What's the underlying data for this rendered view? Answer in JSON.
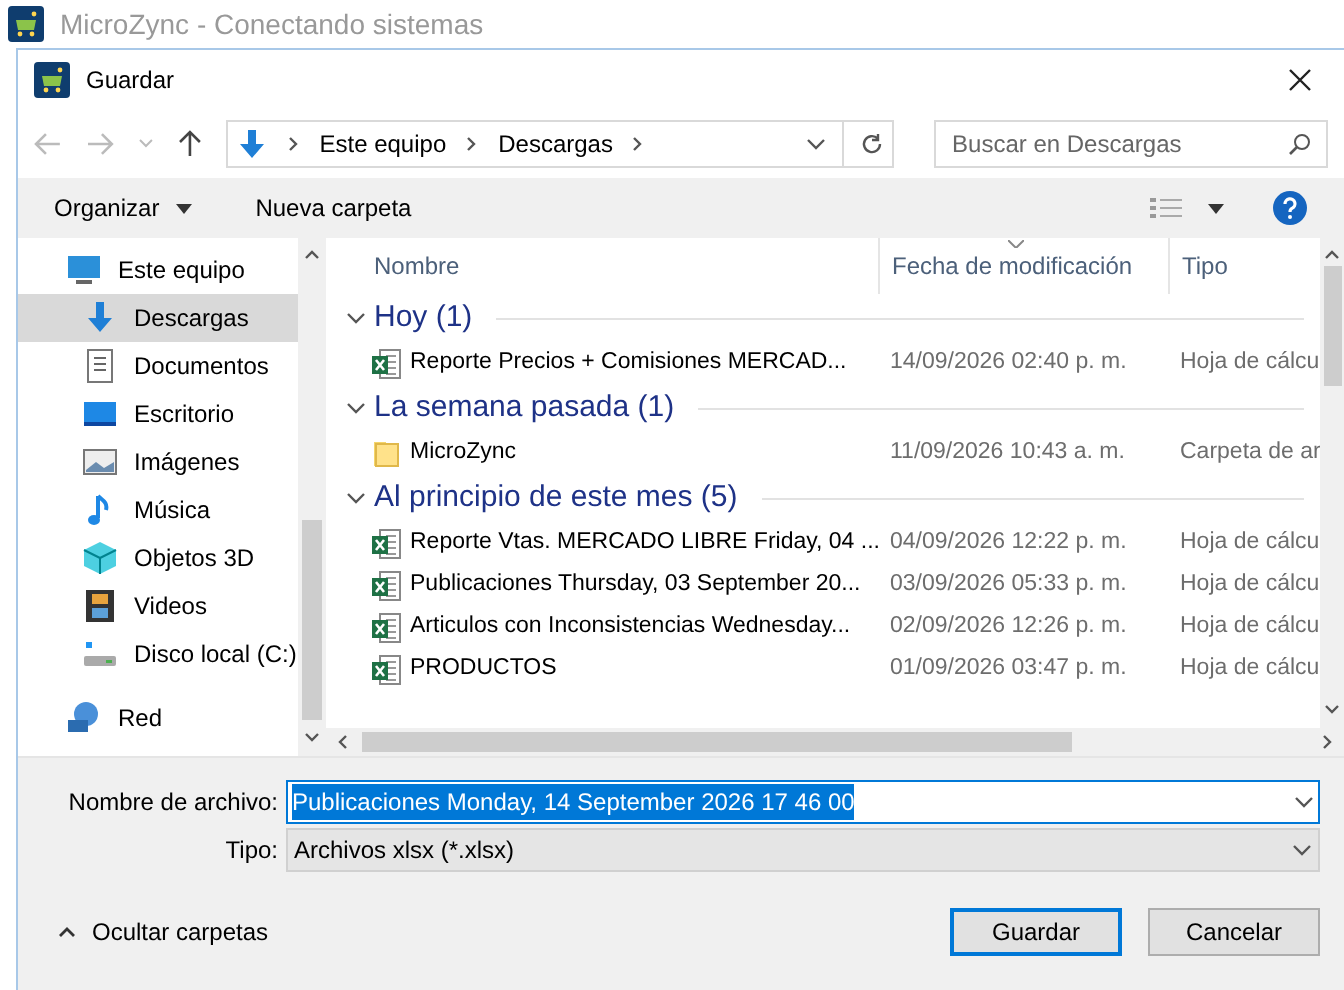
{
  "app_window": {
    "title": "MicroZync - Conectando sistemas"
  },
  "dialog": {
    "title": "Guardar"
  },
  "breadcrumb": [
    "Este equipo",
    "Descargas"
  ],
  "search": {
    "placeholder": "Buscar en Descargas"
  },
  "toolbar": {
    "organize": "Organizar",
    "new_folder": "Nueva carpeta"
  },
  "sidebar": {
    "items": [
      {
        "label": "Este equipo",
        "kind": "computer",
        "selected": false
      },
      {
        "label": "Descargas",
        "kind": "downloads",
        "selected": true
      },
      {
        "label": "Documentos",
        "kind": "documents",
        "selected": false
      },
      {
        "label": "Escritorio",
        "kind": "desktop",
        "selected": false
      },
      {
        "label": "Imágenes",
        "kind": "pictures",
        "selected": false
      },
      {
        "label": "Música",
        "kind": "music",
        "selected": false
      },
      {
        "label": "Objetos 3D",
        "kind": "objects",
        "selected": false
      },
      {
        "label": "Videos",
        "kind": "videos",
        "selected": false
      },
      {
        "label": "Disco local (C:)",
        "kind": "drive",
        "selected": false
      },
      {
        "label": "Red",
        "kind": "network",
        "selected": false
      }
    ]
  },
  "table": {
    "columns": [
      "Nombre",
      "Fecha de modificación",
      "Tipo"
    ],
    "groups": [
      {
        "title": "Hoy (1)",
        "expanded": true,
        "rows": [
          {
            "name": "Reporte Precios + Comisiones MERCAD...",
            "date": "14/09/2026 02:40 p. m.",
            "type": "Hoja de cálcu",
            "kind": "sheet"
          }
        ]
      },
      {
        "title": "La semana pasada (1)",
        "expanded": true,
        "rows": [
          {
            "name": "MicroZync",
            "date": "11/09/2026 10:43 a. m.",
            "type": "Carpeta de ar",
            "kind": "folder"
          }
        ]
      },
      {
        "title": "Al principio de este mes (5)",
        "expanded": true,
        "rows": [
          {
            "name": "Reporte Vtas. MERCADO LIBRE Friday, 04 ...",
            "date": "04/09/2026 12:22 p. m.",
            "type": "Hoja de cálcu",
            "kind": "sheet"
          },
          {
            "name": "Publicaciones Thursday, 03 September 20...",
            "date": "03/09/2026 05:33 p. m.",
            "type": "Hoja de cálcu",
            "kind": "sheet"
          },
          {
            "name": "Articulos con Inconsistencias Wednesday...",
            "date": "02/09/2026 12:26 p. m.",
            "type": "Hoja de cálcu",
            "kind": "sheet"
          },
          {
            "name": "PRODUCTOS",
            "date": "01/09/2026 03:47 p. m.",
            "type": "Hoja de cálcu",
            "kind": "sheet"
          }
        ]
      }
    ]
  },
  "form": {
    "filename_label": "Nombre de archivo:",
    "filename_value": "Publicaciones Monday, 14 September 2026 17 46 00",
    "type_label": "Tipo:",
    "type_value": "Archivos xlsx (*.xlsx)"
  },
  "hide_folders": "Ocultar carpetas",
  "buttons": [
    {
      "label": "Guardar",
      "selected": true
    },
    {
      "label": "Cancelar",
      "selected": false
    }
  ]
}
